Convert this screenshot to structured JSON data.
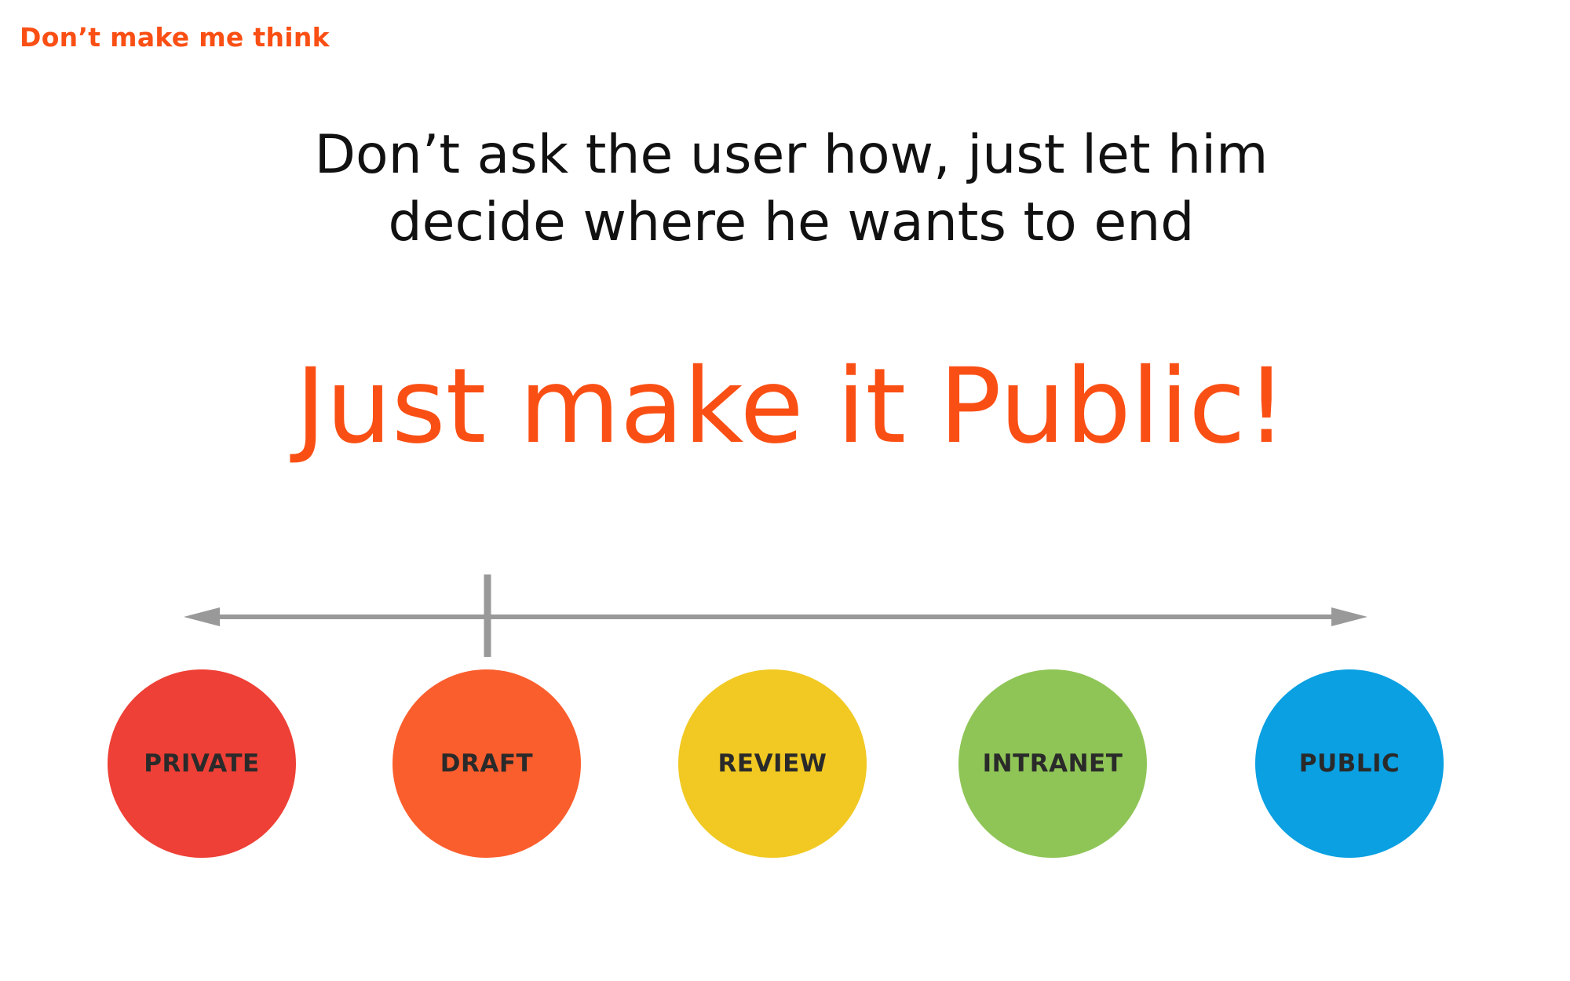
{
  "header": {
    "brand": "Don’t make me think"
  },
  "content": {
    "subtitle_line1": "Don’t ask the user how, just let him",
    "subtitle_line2": "decide where he wants to end",
    "headline": "Just make it Public!"
  },
  "colors": {
    "accent": "#fa4f14",
    "arrow": "#999999"
  },
  "stages": [
    {
      "label": "PRIVATE",
      "color": "#ee4036"
    },
    {
      "label": "DRAFT",
      "color": "#fb5e2d"
    },
    {
      "label": "REVIEW",
      "color": "#f1c922"
    },
    {
      "label": "INTRANET",
      "color": "#8fc556"
    },
    {
      "label": "PUBLIC",
      "color": "#0aa0e2"
    }
  ],
  "current_stage": "DRAFT"
}
